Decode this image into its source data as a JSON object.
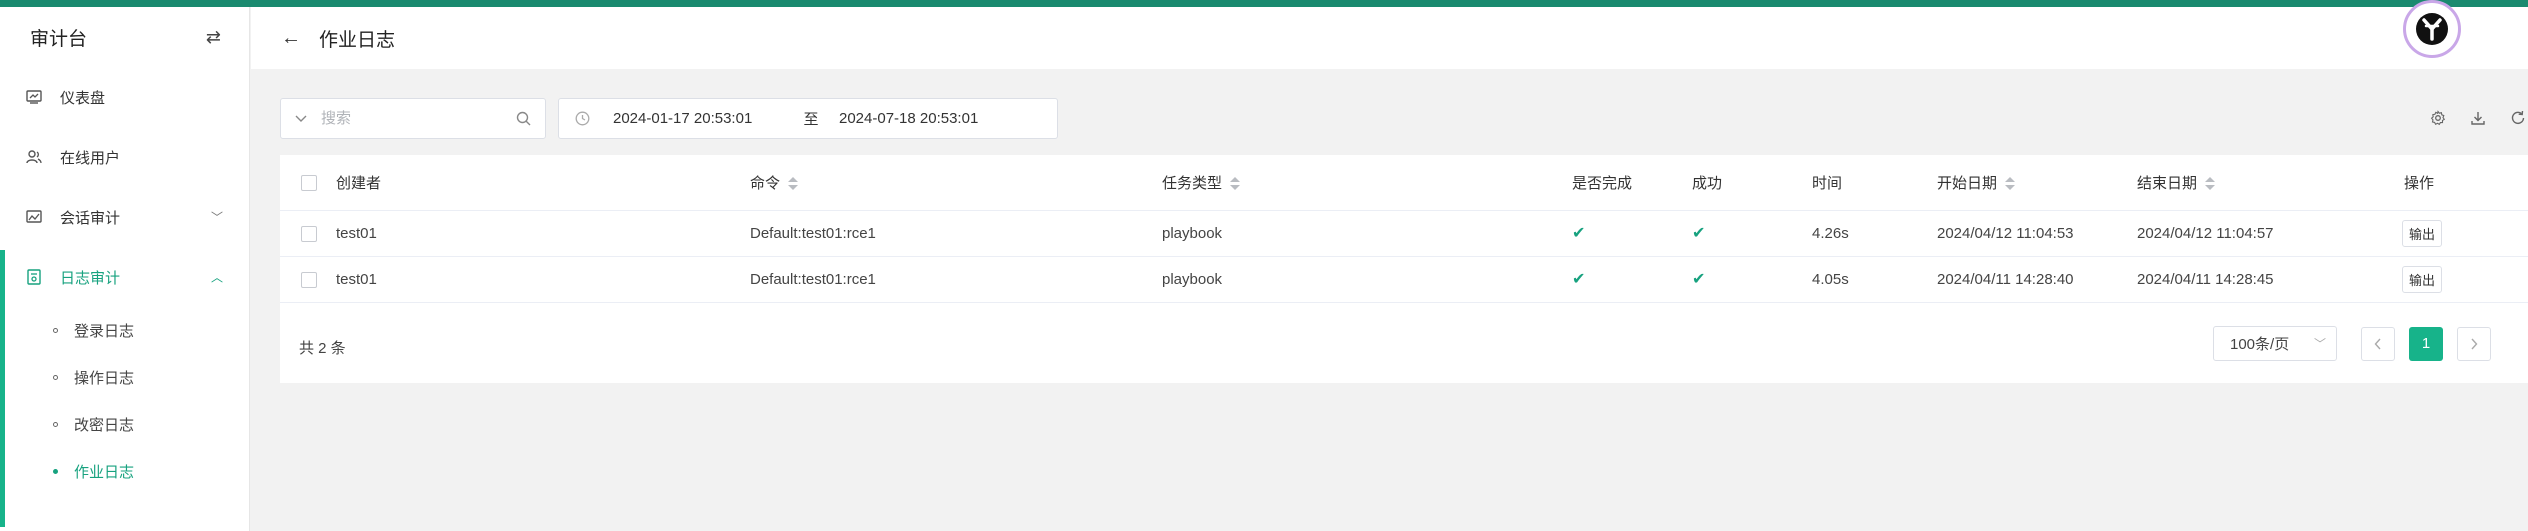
{
  "colors": {
    "accent": "#17b38a",
    "topbar": "#1a8a6f",
    "check": "#17a27f"
  },
  "sidebar": {
    "title": "审计台",
    "toggle_icon": "swap-icon",
    "items": [
      {
        "label": "仪表盘",
        "icon": "dashboard-icon"
      },
      {
        "label": "在线用户",
        "icon": "users-icon"
      },
      {
        "label": "会话审计",
        "icon": "session-icon",
        "expanded": false
      },
      {
        "label": "日志审计",
        "icon": "log-icon",
        "expanded": true,
        "active": true
      }
    ],
    "sub_items": [
      {
        "label": "登录日志"
      },
      {
        "label": "操作日志"
      },
      {
        "label": "改密日志"
      },
      {
        "label": "作业日志",
        "active": true
      }
    ]
  },
  "header": {
    "title": "作业日志"
  },
  "toolbar": {
    "search_placeholder": "搜索",
    "date_start": "2024-01-17 20:53:01",
    "date_separator": "至",
    "date_end": "2024-07-18 20:53:01",
    "tools": [
      "settings-icon",
      "download-icon",
      "refresh-icon"
    ]
  },
  "table": {
    "columns": {
      "creator": "创建者",
      "command": "命令",
      "task_type": "任务类型",
      "finished": "是否完成",
      "success": "成功",
      "time": "时间",
      "start_date": "开始日期",
      "end_date": "结束日期",
      "action": "操作"
    },
    "rows": [
      {
        "creator": "test01",
        "command": "Default:test01:rce1",
        "task_type": "playbook",
        "finished": true,
        "success": true,
        "time": "4.26s",
        "start_date": "2024/04/12 11:04:53",
        "end_date": "2024/04/12 11:04:57",
        "action": "输出"
      },
      {
        "creator": "test01",
        "command": "Default:test01:rce1",
        "task_type": "playbook",
        "finished": true,
        "success": true,
        "time": "4.05s",
        "start_date": "2024/04/11 14:28:40",
        "end_date": "2024/04/11 14:28:45",
        "action": "输出"
      }
    ]
  },
  "pagination": {
    "total": "共 2 条",
    "page_size": "100条/页",
    "current_page": "1"
  }
}
